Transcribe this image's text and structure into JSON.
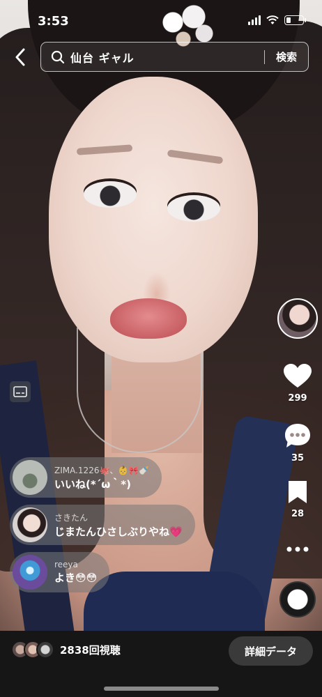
{
  "status_bar": {
    "time": "3:53"
  },
  "search": {
    "query": "仙台 ギャル",
    "button_label": "検索"
  },
  "actions": {
    "likes": "299",
    "comments": "35",
    "saves": "28"
  },
  "comments": [
    {
      "user": "ZIMA.1226🐙、👶🎀🍼",
      "text": "いいね(*´ω｀*)"
    },
    {
      "user": "さきたん",
      "text": "じまたんひさしぶりやね💗"
    },
    {
      "user": "reeya",
      "text": "よき😳😳"
    }
  ],
  "footer": {
    "views": "2838回視聴",
    "detail_button": "詳細データ"
  },
  "colors": {
    "bottom_bar": "#161616",
    "comment_bubble": "#787878"
  }
}
